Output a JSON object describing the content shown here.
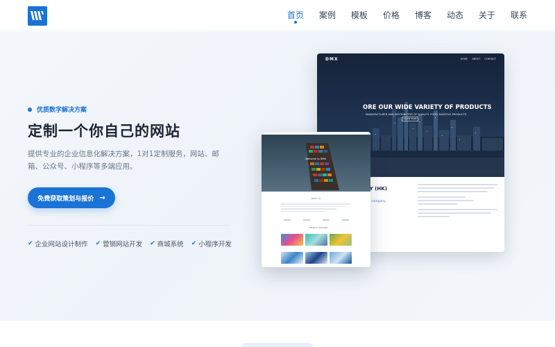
{
  "nav": {
    "items": [
      {
        "label": "首页",
        "active": true
      },
      {
        "label": "案例"
      },
      {
        "label": "模板"
      },
      {
        "label": "价格"
      },
      {
        "label": "博客"
      },
      {
        "label": "动态"
      },
      {
        "label": "关于"
      },
      {
        "label": "联系"
      }
    ]
  },
  "hero": {
    "badge": "优质数字解决方案",
    "title": "定制一个你自己的网站",
    "description": "提供专业的企业信息化解决方案，1对1定制服务，网站、邮箱、公众号、小程序等多端应用。",
    "cta_label": "免费获取策划与报价",
    "cta_arrow": "→",
    "features": [
      {
        "label": "企业网站设计制作",
        "icon": "check-icon"
      },
      {
        "label": "营销网站开发",
        "icon": "check-icon"
      },
      {
        "label": "商城系统",
        "icon": "check-icon"
      },
      {
        "label": "小程序开发",
        "icon": "check-icon"
      }
    ]
  },
  "mockup_large": {
    "brand": "DMX",
    "menu": [
      "HOME",
      "ABOUT",
      "CONTACT"
    ],
    "heading": "ORE OUR WIDE VARIETY OF PRODUCTS",
    "subheading": "MANUFACTURER AND DISTRIBUTOR OF QUALITY FOOD ADDITIVE PRODUCTS",
    "button": "LEARN MORE",
    "company": "OLOGY (HK)",
    "tagline": "d trading company"
  },
  "mockup_small": {
    "welcome": "Welcome to DMX",
    "about": "ABOUT US",
    "products": "PRODUCT SHOWING"
  },
  "colors": {
    "accent": "#1a73d6",
    "title": "#1b2433",
    "text_muted": "#6b7686"
  }
}
